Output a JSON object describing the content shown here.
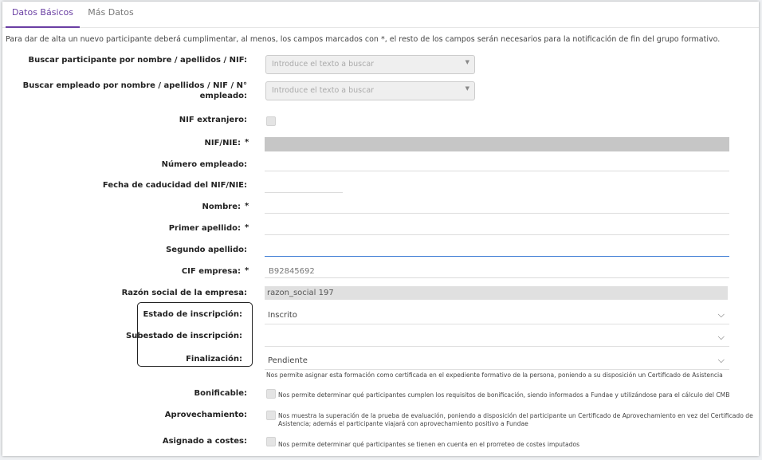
{
  "tabs": [
    {
      "label": "Datos Básicos",
      "active": true
    },
    {
      "label": "Más Datos",
      "active": false
    }
  ],
  "intro": "Para dar de alta un nuevo participante deberá cumplimentar, al menos, los campos marcados con *, el resto de los campos serán necesarios para la notificación de fin del grupo formativo.",
  "fields": {
    "buscar_participante": {
      "label": "Buscar participante por nombre / apellidos / NIF:",
      "placeholder": "Introduce el texto a buscar"
    },
    "buscar_empleado": {
      "label_line1": "Buscar empleado por nombre / apellidos / NIF / N°",
      "label_line2": "empleado:",
      "placeholder": "Introduce el texto a buscar"
    },
    "nif_extranjero": {
      "label": "NIF extranjero:"
    },
    "nif_nie": {
      "label": "NIF/NIE:",
      "required": "*"
    },
    "numero_empleado": {
      "label": "Número empleado:"
    },
    "fecha_caducidad": {
      "label": "Fecha de caducidad del NIF/NIE:"
    },
    "nombre": {
      "label": "Nombre:",
      "required": "*"
    },
    "primer_apellido": {
      "label": "Primer apellido:",
      "required": "*"
    },
    "segundo_apellido": {
      "label": "Segundo apellido:"
    },
    "cif_empresa": {
      "label": "CIF empresa:",
      "required": "*",
      "value": "B92845692"
    },
    "razon_social": {
      "label": "Razón social de la empresa:",
      "value": "razon_social 197"
    },
    "estado_inscripcion": {
      "label": "Estado de inscripción:",
      "value": "Inscrito"
    },
    "subestado_inscripcion": {
      "label": "Subestado de inscripción:",
      "value": ""
    },
    "finalizacion": {
      "label": "Finalización:",
      "value": "Pendiente",
      "help": "Nos permite asignar esta formación como certificada en el expediente formativo de la persona, poniendo a su disposición un Certificado de Asistencia"
    },
    "bonificable": {
      "label": "Bonificable:",
      "help": "Nos permite determinar qué participantes cumplen los requisitos de bonificación, siendo informados a Fundae y utilizándose para el cálculo del CMB"
    },
    "aprovechamiento": {
      "label": "Aprovechamiento:",
      "help_line1": "Nos muestra la superación de la prueba de evaluación, poniendo a disposición del participante un Certificado de Aprovechamiento en vez del Certificado de",
      "help_line2": "Asistencia; además el participante viajará con aprovechamiento positivo a Fundae"
    },
    "asignado_costes": {
      "label": "Asignado a costes:",
      "help": "Nos permite determinar qué participantes se tienen en cuenta en el prorreteo de costes imputados"
    }
  },
  "icons": {
    "select_caret": "caret-down-icon",
    "dropdown_chevron": "chevron-down-icon"
  },
  "colors": {
    "accent": "#6a3fa3",
    "focus": "#3b7bd4"
  }
}
